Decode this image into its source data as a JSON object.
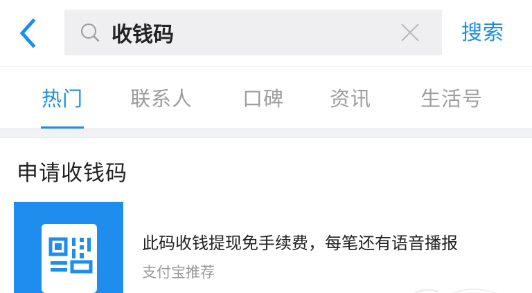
{
  "search": {
    "query": "收钱码",
    "search_button_label": "搜索"
  },
  "tabs": [
    {
      "label": "热门",
      "active": true
    },
    {
      "label": "联系人",
      "active": false
    },
    {
      "label": "口碑",
      "active": false
    },
    {
      "label": "资讯",
      "active": false
    },
    {
      "label": "生活号",
      "active": false
    }
  ],
  "section": {
    "title": "申请收钱码",
    "item": {
      "icon": "qr-code-icon",
      "description": "此码收钱提现免手续费，每笔还有语音播报",
      "source": "支付宝推荐"
    }
  },
  "colors": {
    "accent": "#1a8ee8",
    "thumb_background": "#1f8ded",
    "search_box_background": "#efeff1",
    "inactive_tab": "#9d9d9d"
  },
  "icons": {
    "back": "chevron-left-icon",
    "search": "search-icon",
    "clear": "close-icon"
  }
}
